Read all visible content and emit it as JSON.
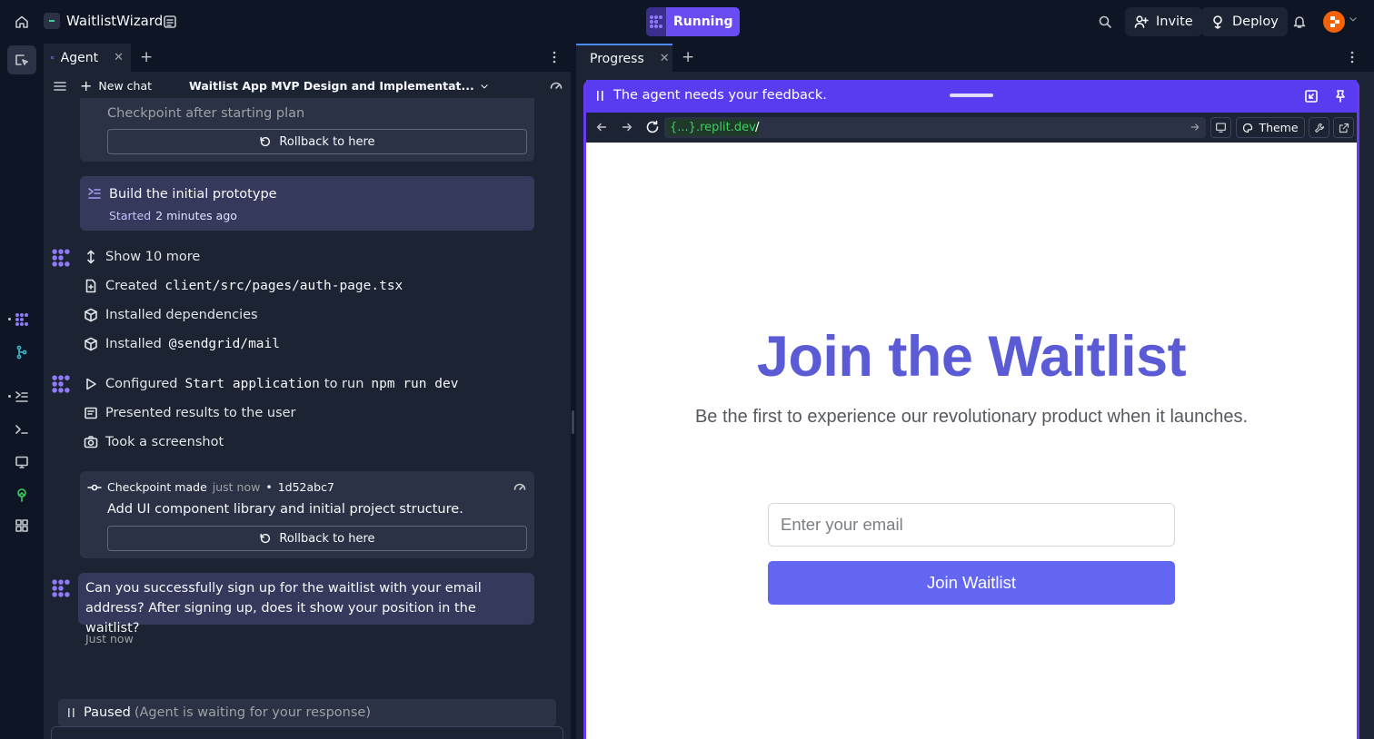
{
  "app": {
    "project_name": "WaitlistWizard",
    "run_status": "Running",
    "invite_label": "Invite",
    "deploy_label": "Deploy"
  },
  "agent_panel": {
    "tab_label": "Agent",
    "new_chat_label": "New chat",
    "chat_title": "Waitlist App MVP Design and Implementat...",
    "checkpoint_prev_text": "Checkpoint after starting plan",
    "rollback_label": "Rollback to here",
    "plan_card": {
      "title": "Build the initial prototype",
      "started_label": "Started",
      "started_time": "2 minutes ago"
    },
    "actions_group1": {
      "show_more": "Show 10 more",
      "created_prefix": "Created",
      "created_path": "client/src/pages/auth-page.tsx",
      "installed_deps": "Installed dependencies",
      "installed_prefix": "Installed",
      "installed_pkg": "@sendgrid/mail"
    },
    "actions_group2": {
      "configured_prefix": "Configured",
      "configured_name": "Start application",
      "configured_mid": "to run",
      "configured_cmd": "npm run dev",
      "presented": "Presented results to the user",
      "screenshot": "Took a screenshot"
    },
    "checkpoint": {
      "label": "Checkpoint made",
      "time": "just now",
      "separator": "•",
      "hash": "1d52abc7",
      "description": "Add UI component library and initial project structure.",
      "rollback_label": "Rollback to here"
    },
    "question": {
      "text": "Can you successfully sign up for the waitlist with your email address? After signing up, does it show your position in the waitlist?",
      "time": "Just now"
    },
    "paused": {
      "label": "Paused",
      "detail": "(Agent is waiting for your response)"
    }
  },
  "progress_panel": {
    "tab_label": "Progress",
    "feedback_text": "The agent needs your feedback.",
    "url_domain": "{...}.replit.dev",
    "url_path": "/",
    "theme_label": "Theme"
  },
  "webpage": {
    "title": "Join the Waitlist",
    "subtitle": "Be the first to experience our revolutionary product when it launches.",
    "email_placeholder": "Enter your email",
    "join_button": "Join Waitlist"
  },
  "colors": {
    "accent_purple": "#5a3cf0",
    "page_title": "#5b5bd6",
    "join_button": "#6366f1",
    "url_domain_green": "#3fcf5f"
  }
}
